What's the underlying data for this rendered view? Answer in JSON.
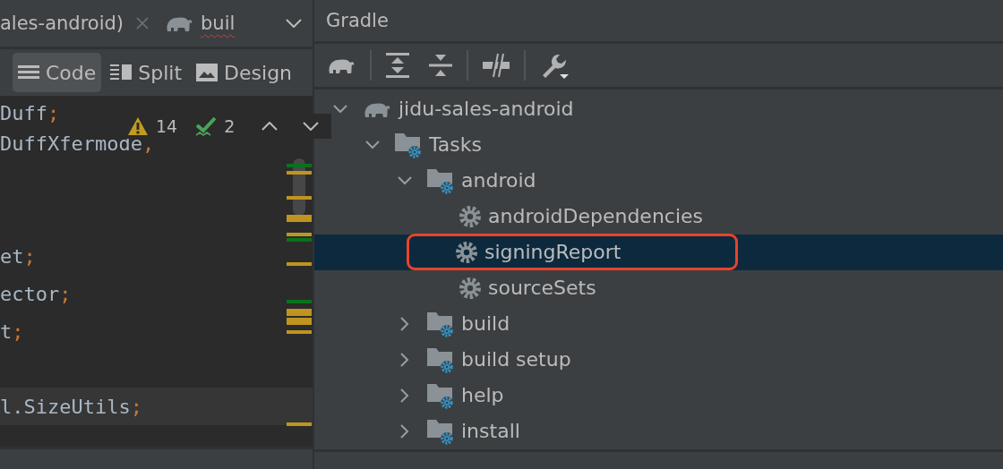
{
  "editor_tabs": [
    {
      "label": "ales-android)",
      "kind": "file",
      "error": false
    },
    {
      "label": "buil",
      "kind": "gradle",
      "error": true
    }
  ],
  "view_modes": [
    {
      "label": "Code",
      "kind": "code",
      "selected": true
    },
    {
      "label": "Split",
      "kind": "split",
      "selected": false
    },
    {
      "label": "Design",
      "kind": "design",
      "selected": false
    }
  ],
  "inspections": {
    "warnings": "14",
    "weak_warnings": "2"
  },
  "code_lines": [
    {
      "kind": "code",
      "text": "Duff",
      "end": ";"
    },
    {
      "kind": "code",
      "text": "DuffXfermode",
      "end": ","
    },
    {
      "kind": "blank"
    },
    {
      "kind": "blank"
    },
    {
      "kind": "code",
      "text": "et",
      "end": ";"
    },
    {
      "kind": "code",
      "text": "ector",
      "end": ";"
    },
    {
      "kind": "code",
      "text": "t",
      "end": ";"
    },
    {
      "kind": "blank"
    }
  ],
  "current_line": {
    "text": "l.SizeUtils",
    "end": ";"
  },
  "gradle": {
    "title": "Gradle",
    "tree": [
      {
        "label": "jidu-sales-android",
        "kind": "project",
        "expanded": true,
        "selected": false,
        "outlined": false,
        "children": [
          {
            "label": "Tasks",
            "kind": "folder",
            "expanded": true,
            "selected": false,
            "outlined": false,
            "children": [
              {
                "label": "android",
                "kind": "folder",
                "expanded": true,
                "selected": false,
                "outlined": false,
                "children": [
                  {
                    "label": "androidDependencies",
                    "kind": "task",
                    "selected": false,
                    "outlined": false
                  },
                  {
                    "label": "signingReport",
                    "kind": "task",
                    "selected": true,
                    "outlined": true
                  },
                  {
                    "label": "sourceSets",
                    "kind": "task",
                    "selected": false,
                    "outlined": false
                  }
                ]
              },
              {
                "label": "build",
                "kind": "folder",
                "expanded": false,
                "selected": false,
                "outlined": false
              },
              {
                "label": "build setup",
                "kind": "folder",
                "expanded": false,
                "selected": false,
                "outlined": false
              },
              {
                "label": "help",
                "kind": "folder",
                "expanded": false,
                "selected": false,
                "outlined": false
              },
              {
                "label": "install",
                "kind": "folder",
                "expanded": false,
                "selected": false,
                "outlined": false
              }
            ]
          }
        ]
      }
    ]
  }
}
